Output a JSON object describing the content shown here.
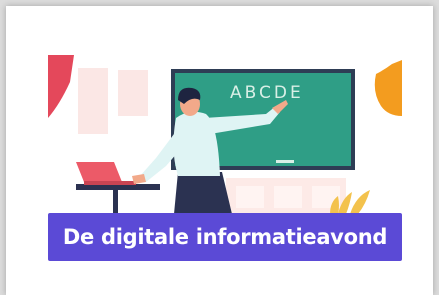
{
  "banner": {
    "title": "De digitale informatieavond"
  },
  "chalkboard": {
    "text": "ABCDE"
  },
  "colors": {
    "banner": "#5b4ad6",
    "chalkboard": "#2f9e86",
    "board_frame": "#2e3d55",
    "shirt": "#dff4f4",
    "pants": "#2b3251",
    "laptop": "#ec5a68",
    "curtain_left": "#e4485b",
    "curtain_right": "#f39c1f"
  }
}
